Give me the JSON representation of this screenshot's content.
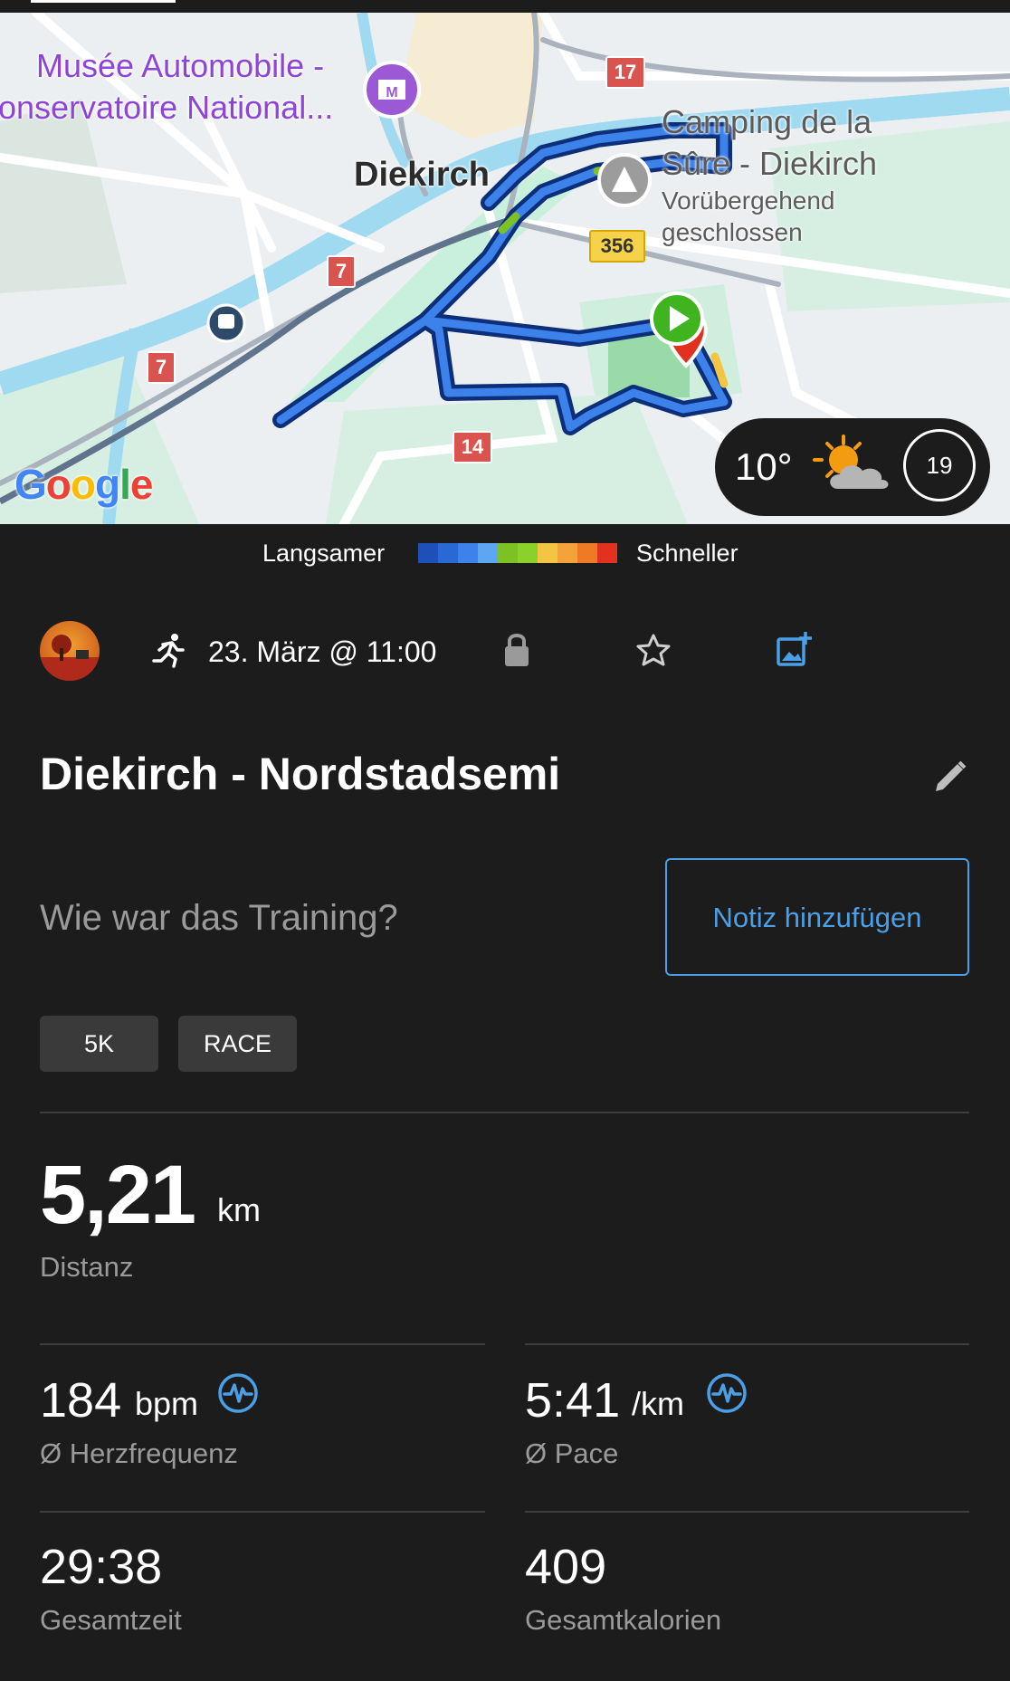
{
  "map": {
    "poi_museum_line1": "Musée Automobile -",
    "poi_museum_line2": "onservatoire National...",
    "town": "Diekirch",
    "camping_line1": "Camping de la",
    "camping_line2": "Sûre - Diekirch",
    "camping_status_line1": "Vorübergehend",
    "camping_status_line2": "geschlossen",
    "road_badges": [
      "17",
      "7",
      "7",
      "356",
      "14"
    ],
    "google_logo": "Google"
  },
  "weather": {
    "temperature": "10°",
    "icon": "partly-sunny-icon",
    "timer": "19"
  },
  "legend": {
    "slower": "Langsamer",
    "faster": "Schneller",
    "colors": [
      "#1f4fb8",
      "#2a68d6",
      "#3c82ea",
      "#5ea6f2",
      "#7cc225",
      "#8ad12c",
      "#f4c542",
      "#f3a33a",
      "#ef7a26",
      "#e0321f"
    ]
  },
  "activity": {
    "type_icon": "running-icon",
    "date": "23. März @ 11:00",
    "title": "Diekirch - Nordstadsemi",
    "note_prompt": "Wie war das Training?",
    "note_button": "Notiz hinzufügen",
    "tags": [
      "5K",
      "RACE"
    ]
  },
  "stats": {
    "distance": {
      "value": "5,21",
      "unit": "km",
      "label": "Distanz"
    },
    "heart_rate": {
      "value": "184",
      "unit": "bpm",
      "label": "Ø Herzfrequenz"
    },
    "pace": {
      "value": "5:41",
      "unit": "/km",
      "label": "Ø Pace"
    },
    "total_time": {
      "value": "29:38",
      "label": "Gesamtzeit"
    },
    "calories": {
      "value": "409",
      "label": "Gesamtkalorien"
    }
  },
  "colors": {
    "accent": "#4a9fe6",
    "background": "#1c1c1c",
    "muted_text": "#9a9a9a"
  }
}
